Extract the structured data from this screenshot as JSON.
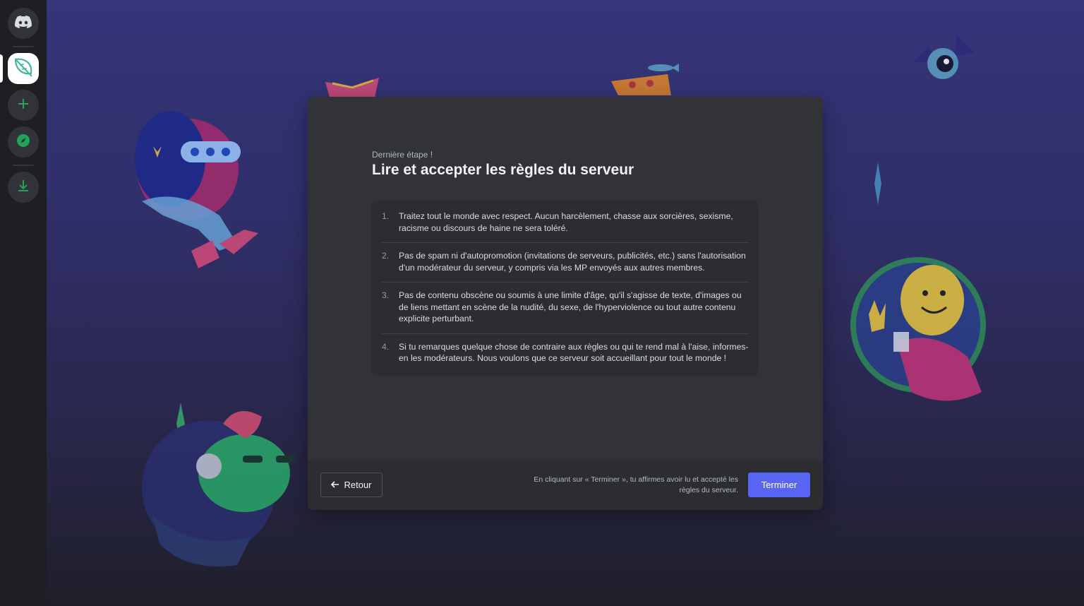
{
  "colors": {
    "accent": "#5865f2",
    "success": "#23a559",
    "modal_bg": "#313338",
    "rules_bg": "#2b2d31"
  },
  "rail": {
    "items": [
      {
        "icon": "discord-logo-icon"
      },
      {
        "icon": "server-leaf-icon"
      },
      {
        "icon": "plus-icon"
      },
      {
        "icon": "compass-icon"
      },
      {
        "icon": "download-icon"
      }
    ]
  },
  "modal": {
    "eyebrow": "Dernière étape !",
    "title": "Lire et accepter les règles du serveur",
    "rules": [
      {
        "num": "1.",
        "text": "Traitez tout le monde avec respect. Aucun harcèlement, chasse aux sorcières, sexisme, racisme ou discours de haine ne sera toléré."
      },
      {
        "num": "2.",
        "text": "Pas de spam ni d'autopromotion (invitations de serveurs, publicités, etc.) sans l'autorisation d'un modérateur du serveur, y compris via les MP envoyés aux autres membres."
      },
      {
        "num": "3.",
        "text": "Pas de contenu obscène ou soumis à une limite d'âge, qu'il s'agisse de texte, d'images ou de liens mettant en scène de la nudité, du sexe, de l'hyperviolence ou tout autre contenu explicite perturbant."
      },
      {
        "num": "4.",
        "text": "Si tu remarques quelque chose de contraire aux règles ou qui te rend mal à l'aise, informes-en les modérateurs. Nous voulons que ce serveur soit accueillant pour tout le monde !"
      }
    ],
    "footer": {
      "back_label": "Retour",
      "consent_text": "En cliquant sur « Terminer », tu affirmes avoir lu et accepté les règles du serveur.",
      "finish_label": "Terminer"
    }
  }
}
